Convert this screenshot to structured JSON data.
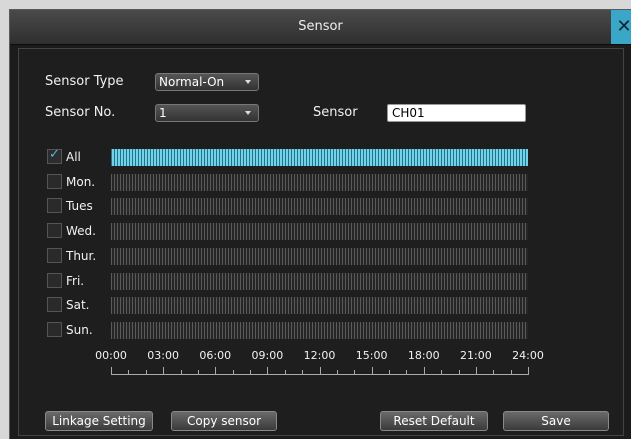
{
  "window": {
    "title": "Sensor",
    "close_label": "✕"
  },
  "form": {
    "sensor_type_label": "Sensor Type",
    "sensor_type_value": "Normal-On",
    "sensor_no_label": "Sensor No.",
    "sensor_no_value": "1",
    "sensor_name_label": "Sensor",
    "sensor_name_value": "CH01"
  },
  "schedule": {
    "days": [
      {
        "label": "All",
        "checked": true
      },
      {
        "label": "Mon.",
        "checked": false
      },
      {
        "label": "Tues",
        "checked": false
      },
      {
        "label": "Wed.",
        "checked": false
      },
      {
        "label": "Thur.",
        "checked": false
      },
      {
        "label": "Fri.",
        "checked": false
      },
      {
        "label": "Sat.",
        "checked": false
      },
      {
        "label": "Sun.",
        "checked": false
      }
    ],
    "hours": [
      "00:00",
      "03:00",
      "06:00",
      "09:00",
      "12:00",
      "15:00",
      "18:00",
      "21:00",
      "24:00"
    ]
  },
  "buttons": {
    "linkage": "Linkage Setting",
    "copy": "Copy sensor",
    "reset": "Reset Default",
    "save": "Save"
  },
  "colors": {
    "accent": "#3aa6c8",
    "active_bar": "#6fd3eb"
  }
}
